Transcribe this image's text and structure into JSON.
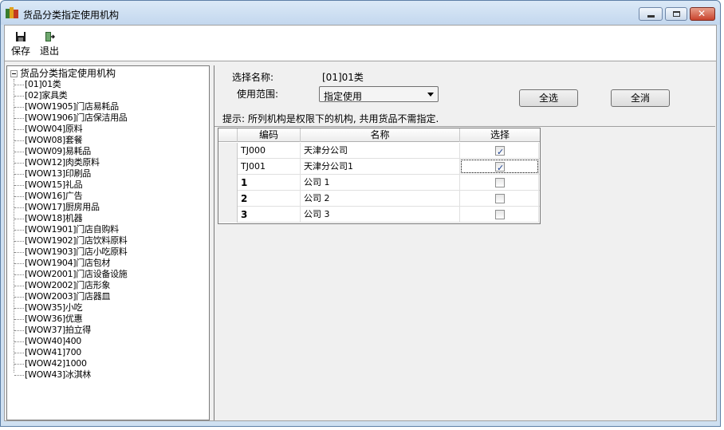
{
  "window": {
    "title": "货品分类指定使用机构",
    "controls": {
      "minimize": "minimize-icon",
      "maximize": "maximize-icon",
      "close": "close-icon"
    }
  },
  "toolbar": {
    "save_label": "保存",
    "exit_label": "退出"
  },
  "tree": {
    "root_label": "货品分类指定使用机构",
    "items": [
      "[01]01类",
      "[02]家具类",
      "[WOW1905]门店易耗品",
      "[WOW1906]门店保洁用品",
      "[WOW04]原料",
      "[WOW08]套餐",
      "[WOW09]易耗品",
      "[WOW12]肉类原料",
      "[WOW13]印刷品",
      "[WOW15]礼品",
      "[WOW16]广告",
      "[WOW17]厨房用品",
      "[WOW18]机器",
      "[WOW1901]门店自购料",
      "[WOW1902]门店饮料原料",
      "[WOW1903]门店小吃原料",
      "[WOW1904]门店包材",
      "[WOW2001]门店设备设施",
      "[WOW2002]门店形象",
      "[WOW2003]门店器皿",
      "[WOW35]小吃",
      "[WOW36]优惠",
      "[WOW37]拍立得",
      "[WOW40]400",
      "[WOW41]700",
      "[WOW42]1000",
      "[WOW43]冰淇林"
    ]
  },
  "form": {
    "category_label": "选择名称:",
    "category_value": "[01]01类",
    "scope_label": "使用范围:",
    "scope_value": "指定使用",
    "select_all_button": "全选",
    "deselect_all_button": "全消",
    "hint": "提示: 所列机构是权限下的机构, 共用货品不需指定."
  },
  "grid": {
    "headers": {
      "code": "编码",
      "name": "名称",
      "select": "选择"
    },
    "rows": [
      {
        "code": "TJ000",
        "name": "天津分公司",
        "checked": true
      },
      {
        "code": "TJ001",
        "name": "天津分公司1",
        "checked": true
      },
      {
        "code": "1",
        "name": "公司 1",
        "checked": false
      },
      {
        "code": "2",
        "name": "公司 2",
        "checked": false
      },
      {
        "code": "3",
        "name": "公司 3",
        "checked": false
      }
    ]
  },
  "colors": {
    "title_bar": "#c3d7ee",
    "close_button": "#c9432d",
    "panel_bg": "#f0f0f0",
    "check_mark": "#1a3f8f"
  }
}
